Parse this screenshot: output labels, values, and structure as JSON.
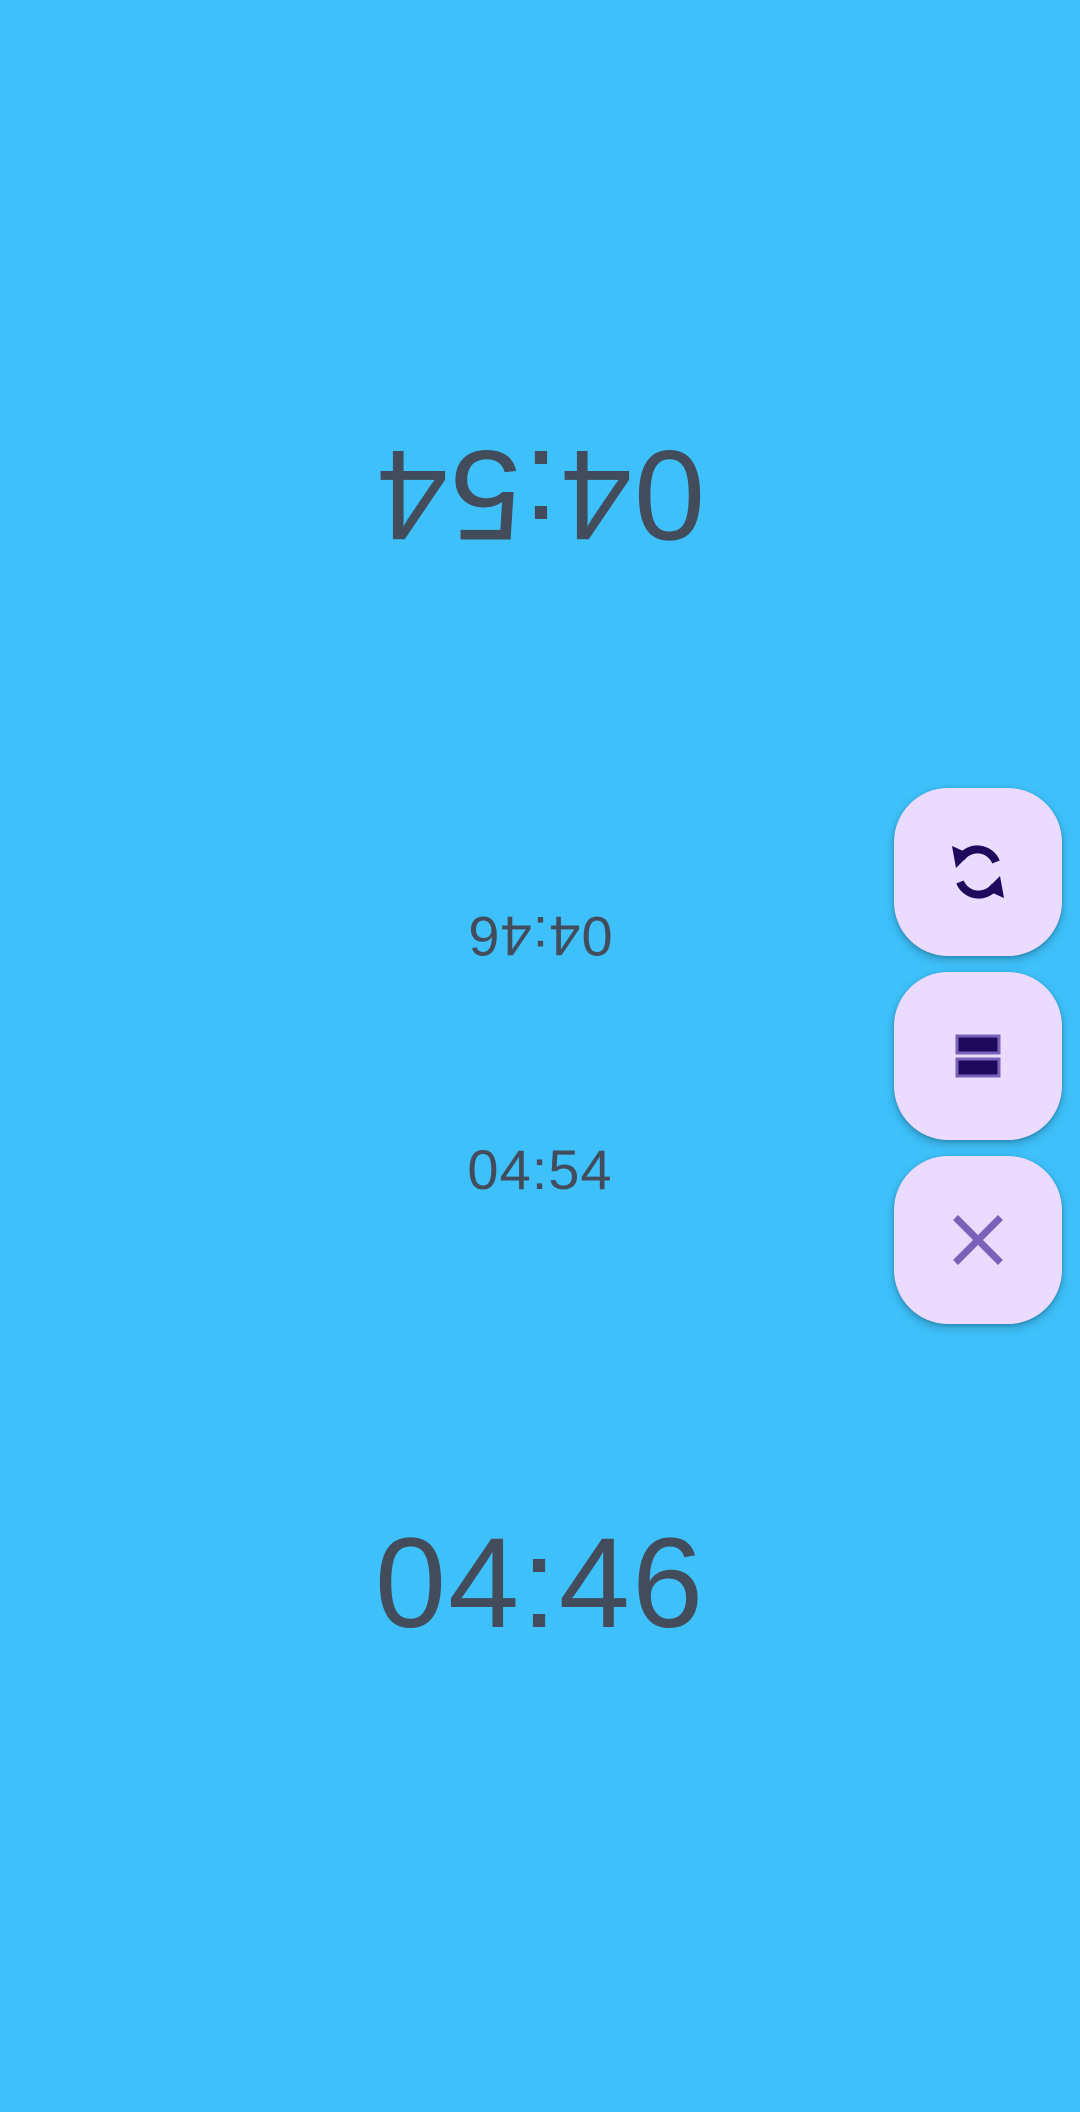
{
  "timers": {
    "opponent_main": "04:54",
    "opponent_secondary": "04:46",
    "player_secondary": "04:54",
    "player_main": "04:46"
  },
  "actions": {
    "rotate_icon": "rotate-icon",
    "pause_icon": "pause-icon",
    "close_icon": "close-icon"
  },
  "colors": {
    "background": "#3ec1fb",
    "timer_text": "#424c5a",
    "fab_background": "#ebdcff",
    "icon_dark": "#1e0a5c",
    "icon_light": "#7b62b8"
  }
}
